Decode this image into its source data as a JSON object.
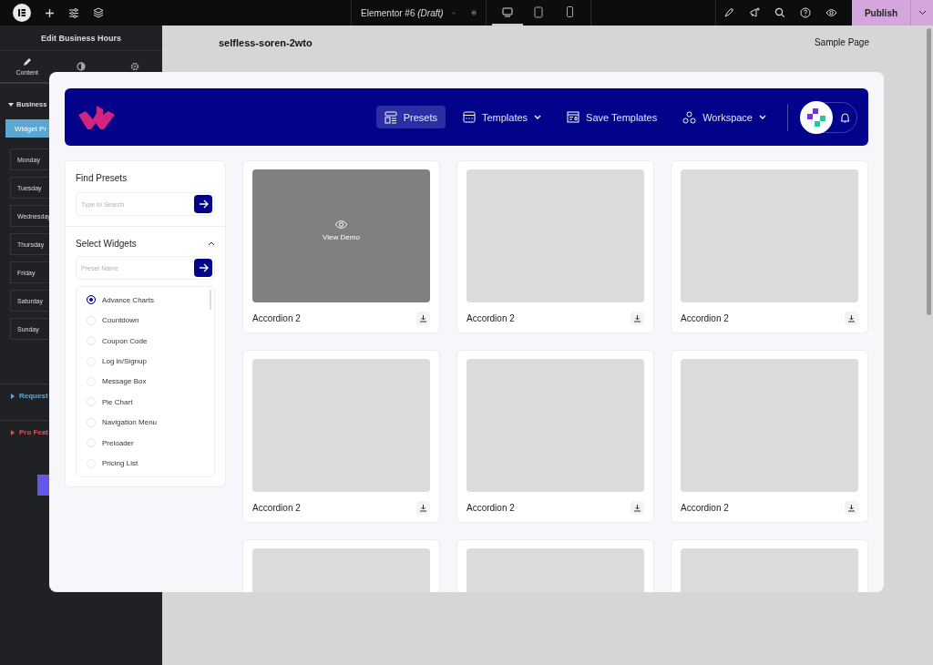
{
  "top_bar": {
    "document_title": "Elementor #6 *(Draft)*",
    "devices": [
      {
        "kind": "desktop",
        "selected": true
      },
      {
        "kind": "tablet",
        "selected": false
      },
      {
        "kind": "mobile",
        "selected": false
      }
    ],
    "publish_button": "Publish"
  },
  "editor_panel": {
    "title": "Edit Business Hours",
    "tabs": [
      {
        "kind": "content",
        "label": "Content",
        "selected": true
      },
      {
        "kind": "style",
        "selected": false
      },
      {
        "kind": "advanced",
        "selected": false
      }
    ],
    "section_title": "Business",
    "preset_button": "Widget Pr",
    "days": [
      "Monday",
      "Tuesday",
      "Wednesday",
      "Thursday",
      "Friday",
      "Saturday",
      "Sunday"
    ],
    "collapsed_sections": [
      {
        "label": "Request",
        "color": "#5fa8d3"
      },
      {
        "label": "Pro Feat",
        "color": "#d9534f"
      }
    ]
  },
  "canvas": {
    "site_title": "selfless-soren-2wto",
    "menu_link": "Sample Page"
  },
  "modal": {
    "nav": [
      {
        "kind": "presets",
        "label": "Presets",
        "selected": true,
        "dropdown": false
      },
      {
        "kind": "templates",
        "label": "Templates",
        "selected": false,
        "dropdown": true
      },
      {
        "kind": "save",
        "label": "Save Templates",
        "selected": false,
        "dropdown": false
      },
      {
        "kind": "workspace",
        "label": "Workspace",
        "selected": false,
        "dropdown": true
      }
    ],
    "find_presets": {
      "title": "Find Presets",
      "placeholder": "Type to Search"
    },
    "select_widgets": {
      "title": "Select Widgets",
      "expanded": true,
      "placeholder": "Preset Name",
      "options": [
        {
          "label": "Advance Charts",
          "selected": true
        },
        {
          "label": "Countdown",
          "selected": false
        },
        {
          "label": "Coupon Code",
          "selected": false
        },
        {
          "label": "Log in/Signup",
          "selected": false
        },
        {
          "label": "Message Box",
          "selected": false
        },
        {
          "label": "Pie Chart",
          "selected": false
        },
        {
          "label": "Navigation Menu",
          "selected": false
        },
        {
          "label": "Preloader",
          "selected": false
        },
        {
          "label": "Pricing List",
          "selected": false
        }
      ]
    },
    "cards": [
      {
        "title": "Accordion 2",
        "hovered": true,
        "overlay_label": "View Demo"
      },
      {
        "title": "Accordion 2",
        "hovered": false
      },
      {
        "title": "Accordion 2",
        "hovered": false
      },
      {
        "title": "Accordion 2",
        "hovered": false
      },
      {
        "title": "Accordion 2",
        "hovered": false
      },
      {
        "title": "Accordion 2",
        "hovered": false
      },
      {
        "hovered": false
      },
      {
        "hovered": false
      },
      {
        "hovered": false
      }
    ]
  }
}
